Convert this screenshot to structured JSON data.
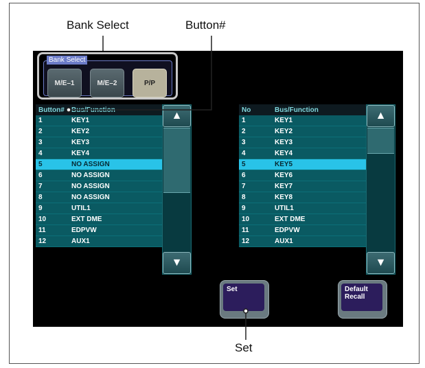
{
  "callouts": {
    "bank_select": "Bank Select",
    "button_num": "Button#",
    "set": "Set"
  },
  "bank": {
    "title": "Bank Select",
    "buttons": [
      "M/E–1",
      "M/E–2",
      "P/P"
    ],
    "active": "P/P"
  },
  "left_list": {
    "headers": {
      "no": "Button#",
      "fn": "Bus/Function"
    },
    "rows": [
      {
        "no": "1",
        "fn": "KEY1"
      },
      {
        "no": "2",
        "fn": "KEY2"
      },
      {
        "no": "3",
        "fn": "KEY3"
      },
      {
        "no": "4",
        "fn": "KEY4"
      },
      {
        "no": "5",
        "fn": "NO ASSIGN"
      },
      {
        "no": "6",
        "fn": "NO ASSIGN"
      },
      {
        "no": "7",
        "fn": "NO ASSIGN"
      },
      {
        "no": "8",
        "fn": "NO ASSIGN"
      },
      {
        "no": "9",
        "fn": "UTIL1"
      },
      {
        "no": "10",
        "fn": "EXT DME"
      },
      {
        "no": "11",
        "fn": "EDPVW"
      },
      {
        "no": "12",
        "fn": "AUX1"
      }
    ],
    "selected_index": 4
  },
  "right_list": {
    "headers": {
      "no": "No",
      "fn": "Bus/Function"
    },
    "rows": [
      {
        "no": "1",
        "fn": "KEY1"
      },
      {
        "no": "2",
        "fn": "KEY2"
      },
      {
        "no": "3",
        "fn": "KEY3"
      },
      {
        "no": "4",
        "fn": "KEY4"
      },
      {
        "no": "5",
        "fn": "KEY5"
      },
      {
        "no": "6",
        "fn": "KEY6"
      },
      {
        "no": "7",
        "fn": "KEY7"
      },
      {
        "no": "8",
        "fn": "KEY8"
      },
      {
        "no": "9",
        "fn": "UTIL1"
      },
      {
        "no": "10",
        "fn": "EXT DME"
      },
      {
        "no": "11",
        "fn": "EDPVW"
      },
      {
        "no": "12",
        "fn": "AUX1"
      }
    ],
    "selected_index": 4
  },
  "buttons": {
    "set": "Set",
    "default_recall": "Default\nRecall"
  },
  "icons": {
    "scroll_up": "triangle-up-icon",
    "scroll_down": "triangle-down-icon"
  }
}
